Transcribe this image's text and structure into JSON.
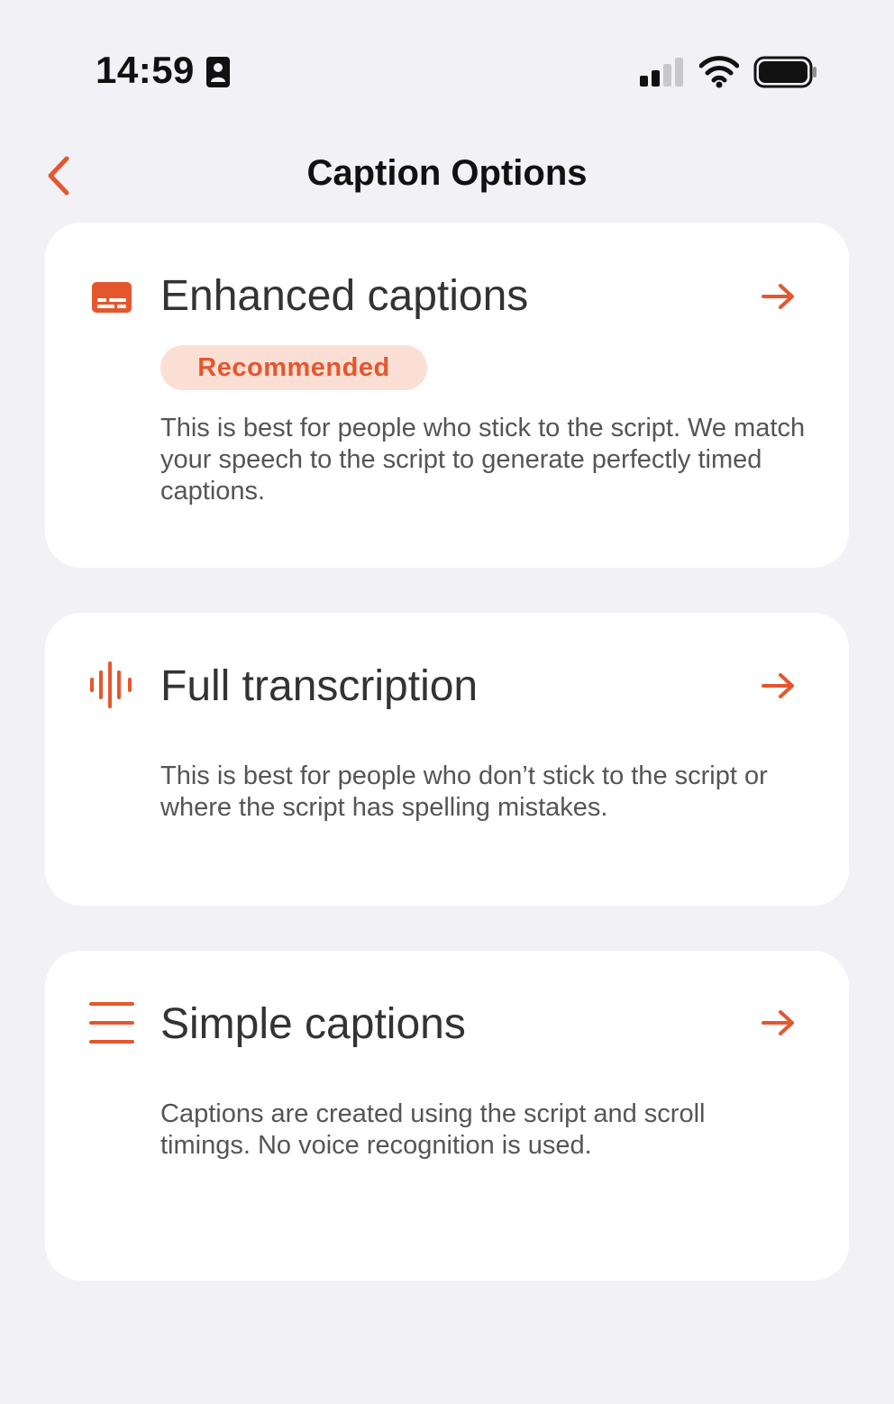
{
  "status_bar": {
    "time": "14:59"
  },
  "nav": {
    "title": "Caption Options"
  },
  "colors": {
    "accent": "#e4572e",
    "badge_bg": "#fbdfd5",
    "background": "#f2f1f6",
    "card_bg": "#ffffff"
  },
  "options": [
    {
      "icon": "captions-icon",
      "title": "Enhanced captions",
      "badge": "Recommended",
      "description": "This is best for people who stick to the script. We match your speech to the script to generate perfectly timed captions."
    },
    {
      "icon": "waveform-icon",
      "title": "Full transcription",
      "description": "This is best for people who don’t stick to the script or where the script has spelling mistakes."
    },
    {
      "icon": "lines-icon",
      "title": "Simple captions",
      "description": "Captions are created using the script and scroll timings. No voice recognition is used."
    }
  ]
}
